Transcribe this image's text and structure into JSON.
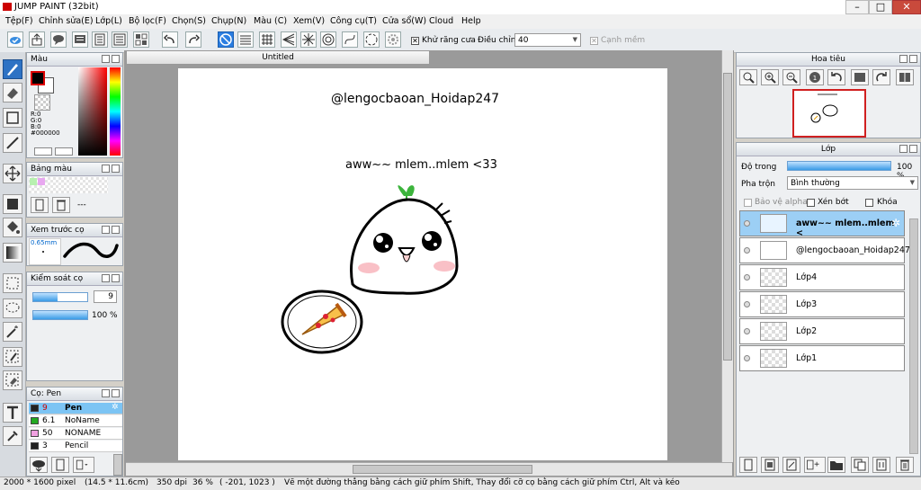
{
  "window": {
    "title": "JUMP PAINT (32bit)",
    "minimize": "–",
    "maximize": "□",
    "close": "✕"
  },
  "menu": [
    "Tệp(F)",
    "Chỉnh sửa(E)",
    "Lớp(L)",
    "Bộ lọc(F)",
    "Chọn(S)",
    "Chụp(N)",
    "Màu (C)",
    "Xem(V)",
    "Công cụ(T)",
    "Cửa sổ(W)",
    "Cloud",
    "Help"
  ],
  "toolbar": {
    "antialias_label": "Khử răng cưa",
    "adjust_label": "Điều chỉnh",
    "adjust_value": "40",
    "sharp_edge_label": "Cạnh mềm"
  },
  "color_panel": {
    "title": "Màu",
    "r": "R:0",
    "g": "G:0",
    "b": "B:0",
    "hex": "#000000",
    "fg_color": "#000000",
    "bg_color": "#ffffff"
  },
  "palette_panel": {
    "title": "Bảng màu",
    "dash": "---",
    "swatches": [
      "#b8f0b0",
      "#e8a8f0"
    ]
  },
  "brush_preview_panel": {
    "title": "Xem trước cọ",
    "size": "0.65mm"
  },
  "brush_control_panel": {
    "title": "Kiểm soát cọ",
    "size_value": "9",
    "size_fraction": 0.45,
    "opacity": "100 %",
    "opacity_fraction": 1.0
  },
  "brushes_panel": {
    "title": "Cọ: Pen",
    "items": [
      {
        "size": "9",
        "name": "Pen",
        "color": "#222222",
        "selected": true
      },
      {
        "size": "6.1",
        "name": "NoName",
        "color": "#22aa22",
        "selected": false
      },
      {
        "size": "50",
        "name": "NONAME",
        "color": "#f0a0e0",
        "selected": false
      },
      {
        "size": "3",
        "name": "Pencil",
        "color": "#222222",
        "selected": false
      }
    ]
  },
  "document": {
    "tab_title": "Untitled",
    "canvas_texts": [
      "@lengocbaoan_Hoidap247",
      "aww~~ mlem..mlem <33"
    ]
  },
  "navigator_panel": {
    "title": "Hoa tiêu"
  },
  "layers_panel": {
    "title": "Lớp",
    "opacity_label": "Độ trong",
    "opacity_value": "100 %",
    "opacity_fraction": 1.0,
    "blend_label": "Pha trộn",
    "blend_value": "Bình thường",
    "protect_alpha": "Bảo vệ alpha",
    "clip": "Xén bớt",
    "lock": "Khóa",
    "layers": [
      {
        "name": "aww~~ mlem..mlem <",
        "selected": true
      },
      {
        "name": "@lengocbaoan_Hoidap247",
        "selected": false
      },
      {
        "name": "Lớp4",
        "selected": false
      },
      {
        "name": "Lớp3",
        "selected": false
      },
      {
        "name": "Lớp2",
        "selected": false
      },
      {
        "name": "Lớp1",
        "selected": false
      }
    ]
  },
  "status": {
    "size": "2000 * 1600 pixel",
    "physical": "(14.5 * 11.6cm)",
    "dpi": "350 dpi",
    "zoom": "36 %",
    "coords": "( -201, 1023 )",
    "hint": "Vẽ một đường thẳng bằng cách giữ phím Shift, Thay đổi cỡ cọ bằng cách giữ phím Ctrl, Alt và kéo"
  }
}
